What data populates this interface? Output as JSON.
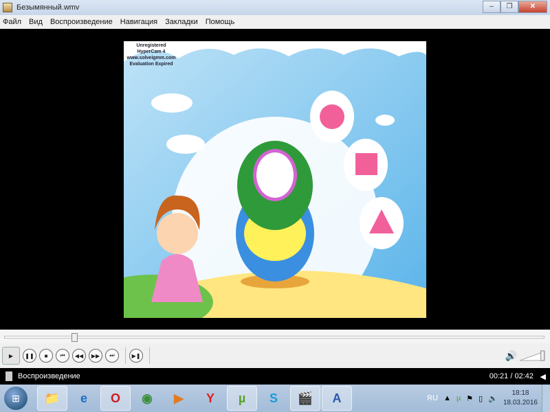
{
  "window": {
    "title": "Безымянный.wmv",
    "minimize": "–",
    "maximize": "❐",
    "close": "✕"
  },
  "menu": [
    "Файл",
    "Вид",
    "Воспроизведение",
    "Навигация",
    "Закладки",
    "Помощь"
  ],
  "watermark": [
    "Unregistered HyperCam 4",
    "www.solveigmm.com",
    "Evaluation Expired"
  ],
  "playback": {
    "progress": 0.13,
    "volume": 0.9
  },
  "controls": [
    {
      "name": "play",
      "glyph": "▶"
    },
    {
      "name": "pause",
      "glyph": "❚❚"
    },
    {
      "name": "stop",
      "glyph": "■"
    },
    {
      "name": "previous",
      "glyph": "⏮"
    },
    {
      "name": "rewind",
      "glyph": "◀◀"
    },
    {
      "name": "forward",
      "glyph": "▶▶"
    },
    {
      "name": "next",
      "glyph": "⏭"
    }
  ],
  "frame_step": {
    "glyph": "▶❚"
  },
  "status": {
    "text": "Воспроизведение",
    "time": "00:21 / 02:42"
  },
  "taskbar": {
    "items": [
      {
        "name": "explorer",
        "glyph": "📁",
        "color": "#e8b94a",
        "pinned": true
      },
      {
        "name": "internet-explorer",
        "glyph": "e",
        "color": "#1d6fc4",
        "pinned": false
      },
      {
        "name": "opera",
        "glyph": "O",
        "color": "#d0191e",
        "pinned": true
      },
      {
        "name": "chrome",
        "glyph": "◉",
        "color": "#3a8f3a",
        "pinned": false
      },
      {
        "name": "media-player",
        "glyph": "▶",
        "color": "#e07b22",
        "pinned": false
      },
      {
        "name": "yandex",
        "glyph": "Y",
        "color": "#e0201c",
        "pinned": false
      },
      {
        "name": "utorrent",
        "glyph": "µ",
        "color": "#5aa02c",
        "pinned": true
      },
      {
        "name": "skype",
        "glyph": "S",
        "color": "#1a9bd8",
        "pinned": false
      },
      {
        "name": "media-player-classic",
        "glyph": "🎬",
        "color": "#555",
        "pinned": true
      },
      {
        "name": "word",
        "glyph": "A",
        "color": "#2a5aa8",
        "pinned": true
      }
    ],
    "language": "RU",
    "clock_time": "18:18",
    "clock_date": "18.03.2016"
  }
}
